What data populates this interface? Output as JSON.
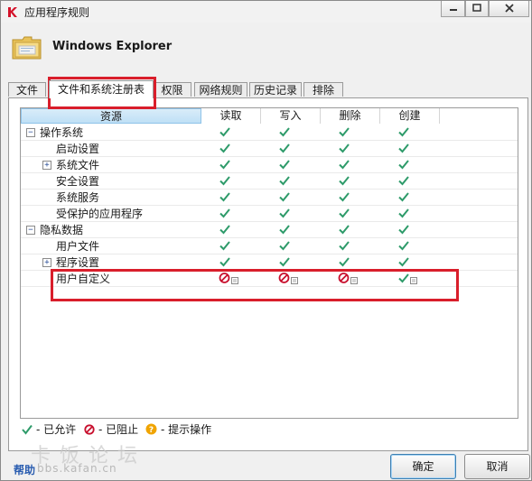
{
  "window": {
    "title": "应用程序规则",
    "app_name": "Windows Explorer"
  },
  "tabs": [
    {
      "label": "文件"
    },
    {
      "label": "文件和系统注册表",
      "active": true
    },
    {
      "label": "权限"
    },
    {
      "label": "网络规则"
    },
    {
      "label": "历史记录"
    },
    {
      "label": "排除"
    }
  ],
  "columns": {
    "resource": "资源",
    "read": "读取",
    "write": "写入",
    "delete": "删除",
    "create": "创建"
  },
  "rows": [
    {
      "label": "操作系统",
      "level": 0,
      "expander": "minus",
      "perms": [
        "allow",
        "allow",
        "allow",
        "allow"
      ]
    },
    {
      "label": "启动设置",
      "level": 1,
      "expander": null,
      "perms": [
        "allow",
        "allow",
        "allow",
        "allow"
      ]
    },
    {
      "label": "系统文件",
      "level": 1,
      "expander": "plus",
      "perms": [
        "allow",
        "allow",
        "allow",
        "allow"
      ]
    },
    {
      "label": "安全设置",
      "level": 1,
      "expander": null,
      "perms": [
        "allow",
        "allow",
        "allow",
        "allow"
      ]
    },
    {
      "label": "系统服务",
      "level": 1,
      "expander": null,
      "perms": [
        "allow",
        "allow",
        "allow",
        "allow"
      ]
    },
    {
      "label": "受保护的应用程序",
      "level": 1,
      "expander": null,
      "perms": [
        "allow",
        "allow",
        "allow",
        "allow"
      ]
    },
    {
      "label": "隐私数据",
      "level": 0,
      "expander": "minus",
      "perms": [
        "allow",
        "allow",
        "allow",
        "allow"
      ]
    },
    {
      "label": "用户文件",
      "level": 1,
      "expander": null,
      "perms": [
        "allow",
        "allow",
        "allow",
        "allow"
      ]
    },
    {
      "label": "程序设置",
      "level": 1,
      "expander": "plus",
      "perms": [
        "allow",
        "allow",
        "allow",
        "allow"
      ]
    },
    {
      "label": "用户自定义",
      "level": 1,
      "expander": null,
      "perms": [
        "block",
        "block",
        "block",
        "allow"
      ],
      "has_log": true
    }
  ],
  "legend": {
    "allowed": "- 已允许",
    "blocked": "- 已阻止",
    "prompt": "- 提示操作"
  },
  "footer": {
    "help": "帮助",
    "ok": "确定",
    "cancel": "取消"
  },
  "watermark": {
    "text": "卡饭论坛",
    "url": "bbs.kafan.cn"
  },
  "colors": {
    "allow": "#2e9b6a",
    "block": "#c8102e",
    "prompt": "#f0a400",
    "annotation": "#d91e2b",
    "help_link": "#2a5db0"
  }
}
